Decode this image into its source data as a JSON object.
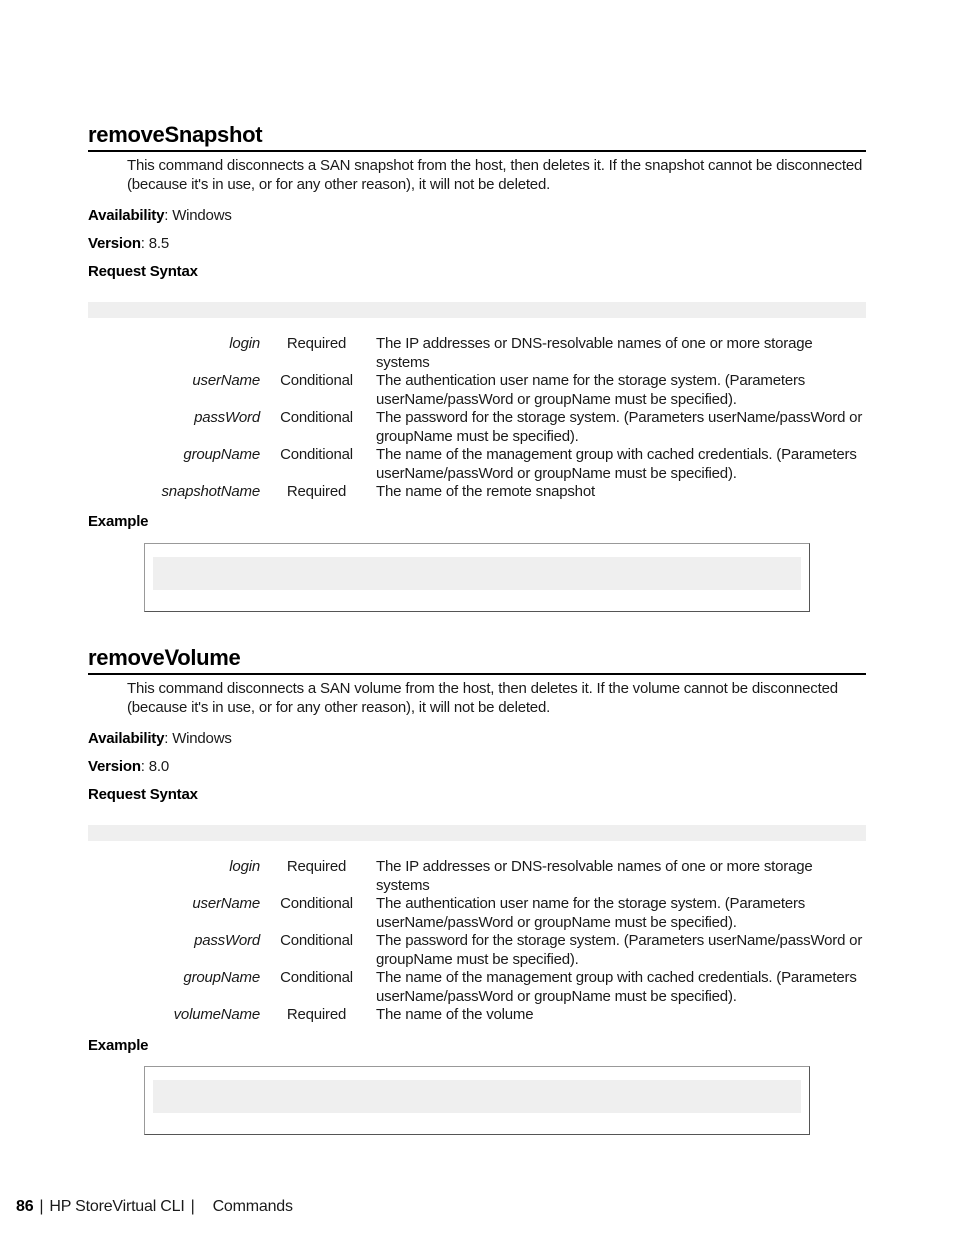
{
  "sections": [
    {
      "title": "removeSnapshot",
      "description": "This command disconnects a SAN snapshot from the host, then deletes it. If the snapshot cannot be disconnected (because it's in use, or for any other reason), it will not be deleted.",
      "availability_label": "Availability",
      "availability": "Windows",
      "version_label": "Version",
      "version": "8.5",
      "request_syntax_label": "Request Syntax",
      "request_syntax": "",
      "parameters": [
        {
          "name": "login",
          "requirement": "Required",
          "description": "The IP addresses or DNS-resolvable names of one or more storage systems"
        },
        {
          "name": "userName",
          "requirement": "Conditional",
          "description": "The authentication user name for the storage system. (Parameters userName/passWord or groupName must be specified)."
        },
        {
          "name": "passWord",
          "requirement": "Conditional",
          "description": "The password for the storage system. (Parameters userName/passWord or groupName must be specified)."
        },
        {
          "name": "groupName",
          "requirement": "Conditional",
          "description": "The name of the management group with cached credentials. (Parameters userName/passWord or groupName must be specified)."
        },
        {
          "name": "snapshotName",
          "requirement": "Required",
          "description": "The name of the remote snapshot"
        }
      ],
      "example_label": "Example",
      "example": ""
    },
    {
      "title": "removeVolume",
      "description": "This command disconnects a SAN volume from the host, then deletes it. If the volume cannot be disconnected (because it's in use, or for any other reason), it will not be deleted.",
      "availability_label": "Availability",
      "availability": "Windows",
      "version_label": "Version",
      "version": "8.0",
      "request_syntax_label": "Request Syntax",
      "request_syntax": "",
      "parameters": [
        {
          "name": "login",
          "requirement": "Required",
          "description": "The IP addresses or DNS-resolvable names of one or more storage systems"
        },
        {
          "name": "userName",
          "requirement": "Conditional",
          "description": "The authentication user name for the storage system. (Parameters userName/passWord or groupName must be specified)."
        },
        {
          "name": "passWord",
          "requirement": "Conditional",
          "description": "The password for the storage system. (Parameters userName/passWord or groupName must be specified)."
        },
        {
          "name": "groupName",
          "requirement": "Conditional",
          "description": "The name of the management group with cached credentials. (Parameters userName/passWord or groupName must be specified)."
        },
        {
          "name": "volumeName",
          "requirement": "Required",
          "description": "The name of the volume"
        }
      ],
      "example_label": "Example",
      "example": ""
    }
  ],
  "footer": {
    "page_number": "86",
    "separator": "|",
    "book_title": "HP StoreVirtual CLI",
    "chapter": "Commands"
  }
}
